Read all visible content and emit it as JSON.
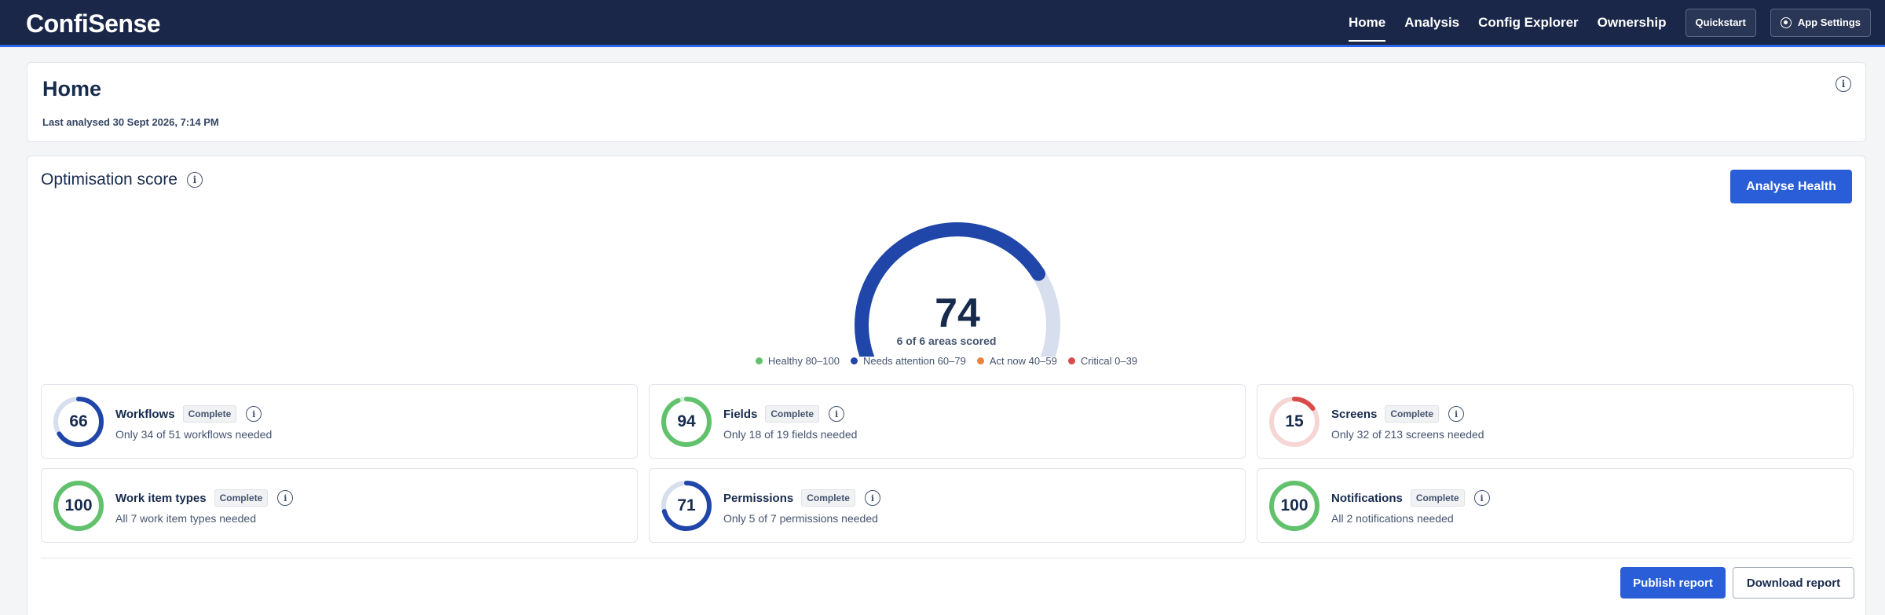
{
  "app": {
    "name": "ConfiSense"
  },
  "nav": {
    "links": [
      "Home",
      "Analysis",
      "Config Explorer",
      "Ownership"
    ],
    "active": "Home",
    "quickstart_label": "Quickstart",
    "settings_label": "App Settings",
    "settings_icon": "gear-icon"
  },
  "home": {
    "title": "Home",
    "last_analysed": "Last analysed 30 Sept 2026, 7:14 PM",
    "info_glyph": "i"
  },
  "score": {
    "title": "Optimisation score",
    "info_glyph": "i",
    "analyse_label": "Analyse Health",
    "value": "74",
    "value_fraction": 0.74,
    "subtitle": "6 of 6 areas scored",
    "gauge_color": "#1f46a8",
    "track_color": "#d7deed"
  },
  "legend": [
    {
      "label": "Healthy 80–100",
      "color": "#62c16d"
    },
    {
      "label": "Needs attention 60–79",
      "color": "#1f46a8"
    },
    {
      "label": "Act now 40–59",
      "color": "#e8833a"
    },
    {
      "label": "Critical 0–39",
      "color": "#d94a4a"
    }
  ],
  "metrics": [
    {
      "name": "Workflows",
      "badge": "Complete",
      "score": "66",
      "fraction": 0.66,
      "desc": "Only 34 of 51 workflows needed",
      "color": "#1f46a8",
      "track": "#d7deed"
    },
    {
      "name": "Fields",
      "badge": "Complete",
      "score": "94",
      "fraction": 0.94,
      "desc": "Only 18 of 19 fields needed",
      "color": "#62c16d",
      "track": "#d7eed9"
    },
    {
      "name": "Screens",
      "badge": "Complete",
      "score": "15",
      "fraction": 0.15,
      "desc": "Only 32 of 213 screens needed",
      "color": "#d94a4a",
      "track": "#f6d5d5"
    },
    {
      "name": "Work item types",
      "badge": "Complete",
      "score": "100",
      "fraction": 1.0,
      "desc": "All 7 work item types needed",
      "color": "#62c16d",
      "track": "#d7eed9"
    },
    {
      "name": "Permissions",
      "badge": "Complete",
      "score": "71",
      "fraction": 0.71,
      "desc": "Only 5 of 7 permissions needed",
      "color": "#1f46a8",
      "track": "#d7deed"
    },
    {
      "name": "Notifications",
      "badge": "Complete",
      "score": "100",
      "fraction": 1.0,
      "desc": "All 2 notifications needed",
      "color": "#62c16d",
      "track": "#d7eed9"
    }
  ],
  "actions": {
    "publish_label": "Publish report",
    "download_label": "Download report"
  }
}
